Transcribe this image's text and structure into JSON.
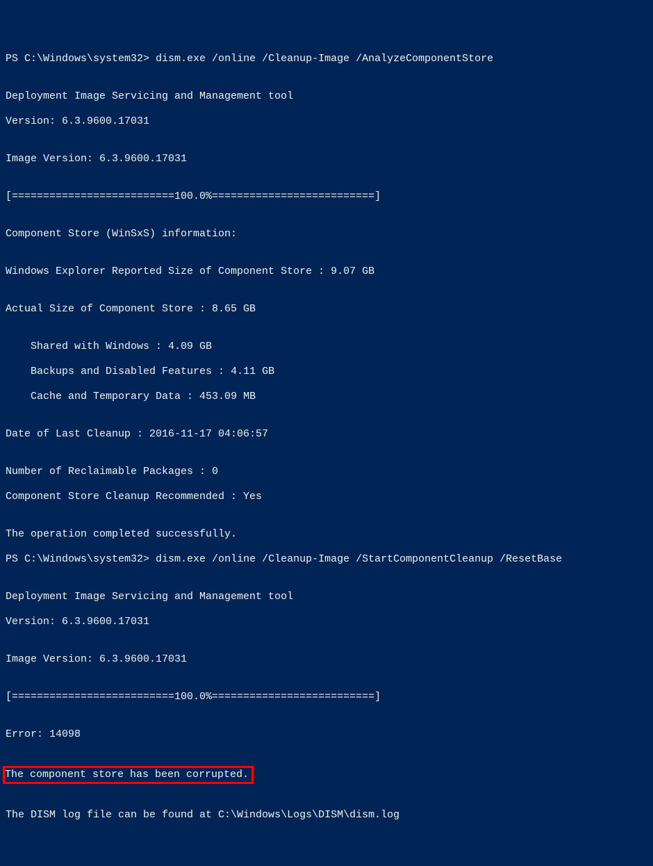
{
  "terminal": {
    "prompt1": "PS C:\\Windows\\system32> ",
    "cmd1": "dism.exe /online /Cleanup-Image /AnalyzeComponentStore",
    "blank": "",
    "tool_header": "Deployment Image Servicing and Management tool",
    "tool_version": "Version: 6.3.9600.17031",
    "image_version": "Image Version: 6.3.9600.17031",
    "progress": "[==========================100.0%==========================]",
    "winsxs_header": "Component Store (WinSxS) information:",
    "reported_size": "Windows Explorer Reported Size of Component Store : 9.07 GB",
    "actual_size": "Actual Size of Component Store : 8.65 GB",
    "shared": "    Shared with Windows : 4.09 GB",
    "backups": "    Backups and Disabled Features : 4.11 GB",
    "cache": "    Cache and Temporary Data : 453.09 MB",
    "last_cleanup": "Date of Last Cleanup : 2016-11-17 04:06:57",
    "reclaimable": "Number of Reclaimable Packages : 0",
    "recommended": "Component Store Cleanup Recommended : Yes",
    "success": "The operation completed successfully.",
    "prompt2": "PS C:\\Windows\\system32> ",
    "cmd2": "dism.exe /online /Cleanup-Image /StartComponentCleanup /ResetBase",
    "error_code": "Error: 14098",
    "error_msg": "The component store has been corrupted.",
    "log_path": "The DISM log file can be found at C:\\Windows\\Logs\\DISM\\dism.log"
  }
}
